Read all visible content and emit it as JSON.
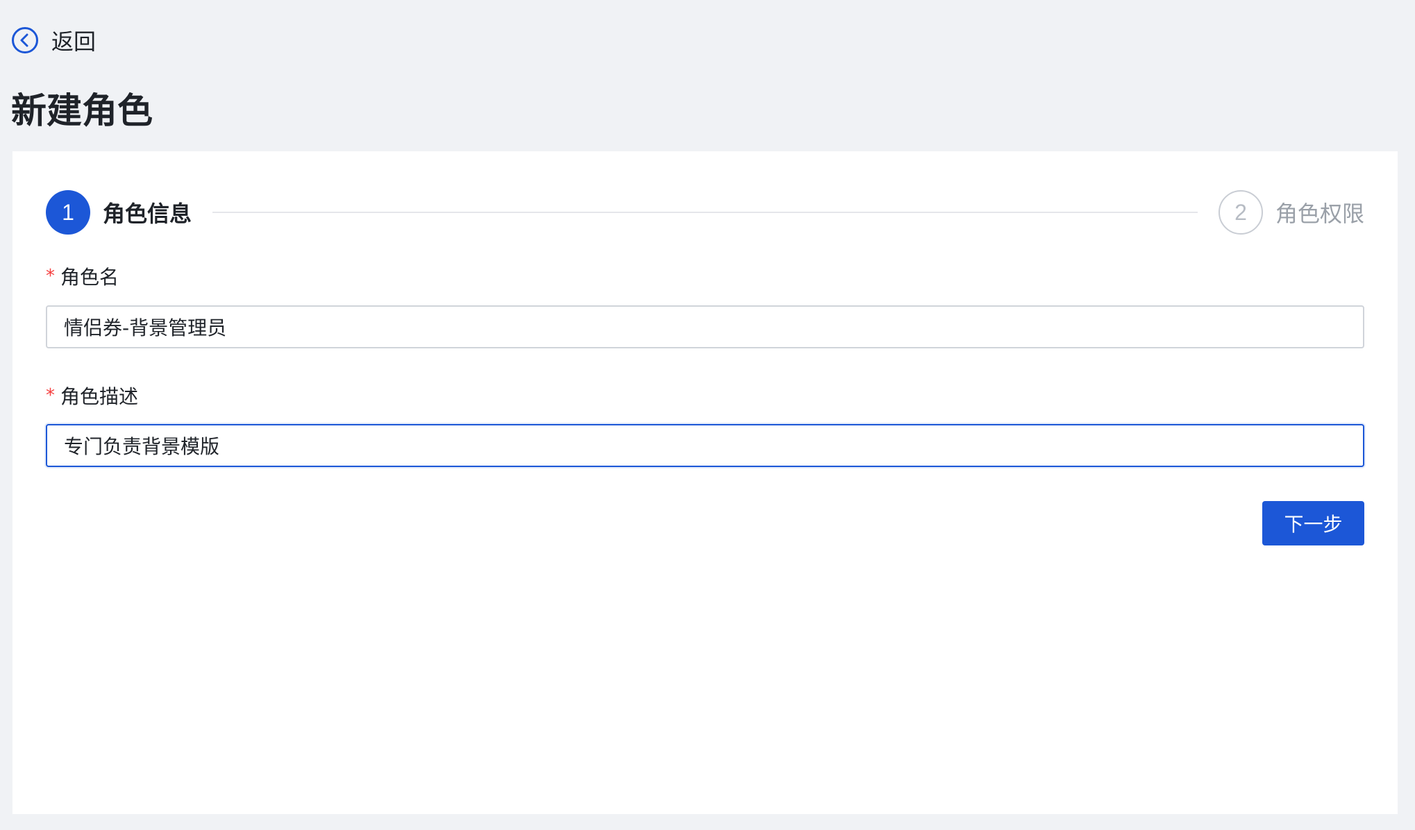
{
  "header": {
    "back_label": "返回",
    "back_icon": "chevron-left-circle-icon",
    "title": "新建角色"
  },
  "steps": [
    {
      "number": "1",
      "label": "角色信息",
      "state": "active"
    },
    {
      "number": "2",
      "label": "角色权限",
      "state": "inactive"
    }
  ],
  "form": {
    "role_name": {
      "label": "角色名",
      "required_mark": "*",
      "value": "情侣券-背景管理员"
    },
    "role_description": {
      "label": "角色描述",
      "required_mark": "*",
      "value": "专门负责背景模版"
    },
    "next_label": "下一步"
  },
  "colors": {
    "accent": "#1c57d7",
    "required": "#f53f3f",
    "background": "#f0f2f5",
    "card": "#ffffff"
  }
}
